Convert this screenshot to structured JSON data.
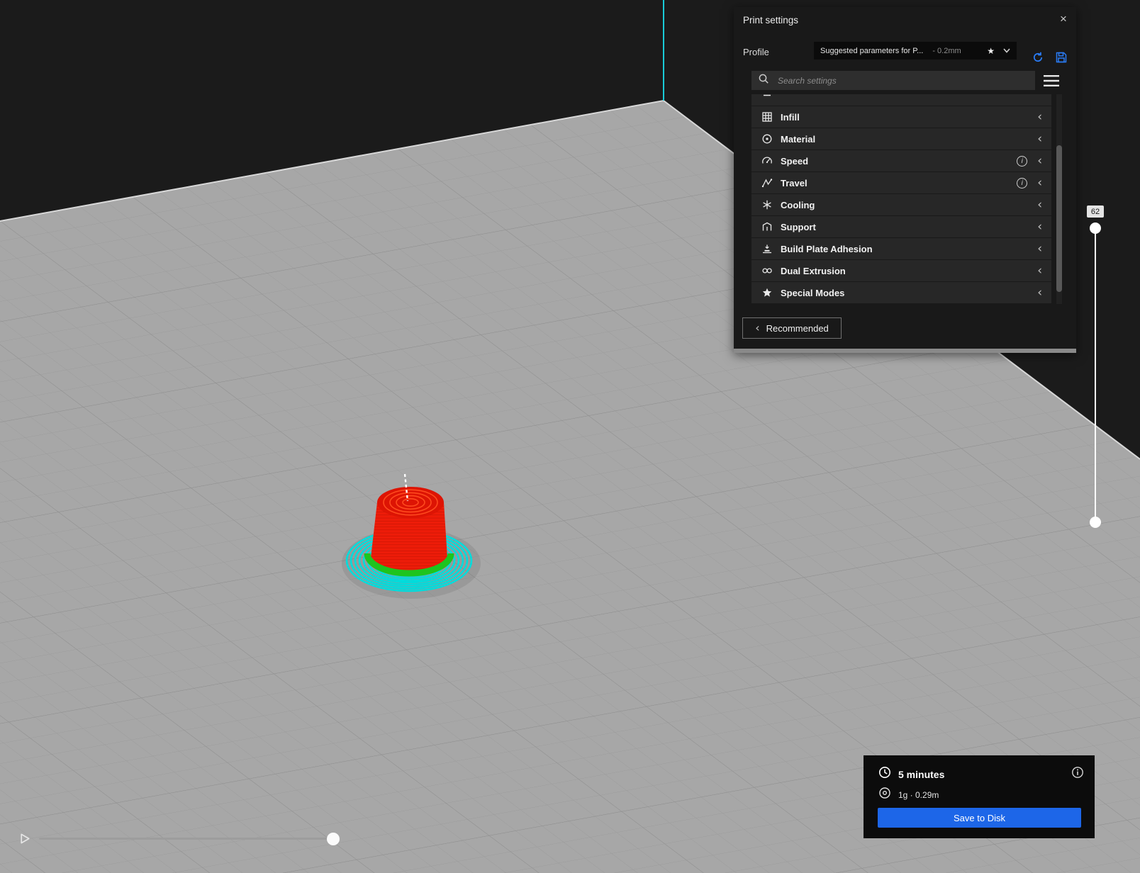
{
  "print_settings": {
    "title": "Print settings",
    "profile": {
      "label": "Profile",
      "value": "Suggested parameters for P...",
      "variant": "- 0.2mm"
    },
    "search_placeholder": "Search settings",
    "categories": [
      {
        "label": "Infill",
        "info": false
      },
      {
        "label": "Material",
        "info": false
      },
      {
        "label": "Speed",
        "info": true
      },
      {
        "label": "Travel",
        "info": true
      },
      {
        "label": "Cooling",
        "info": false
      },
      {
        "label": "Support",
        "info": false
      },
      {
        "label": "Build Plate Adhesion",
        "info": false
      },
      {
        "label": "Dual Extrusion",
        "info": false
      },
      {
        "label": "Special Modes",
        "info": false
      }
    ],
    "recommended": "Recommended"
  },
  "layer_slider": {
    "value": "62"
  },
  "job_summary": {
    "time": "5 minutes",
    "material": "1g · 0.29m",
    "save_button": "Save to Disk"
  },
  "icons": {
    "close": "×",
    "star": "★",
    "chevron": "‹",
    "info": "i"
  },
  "colors": {
    "accent_blue": "#1d66e8",
    "profile_icon_blue": "#2a7cf7",
    "model_red": "#ed1c09",
    "ring_green": "#1ec41e",
    "brim_cyan": "#00dcdc",
    "plate_gray": "#a7a7a7",
    "background_dark": "#1b1b1b",
    "axis_cyan": "#19ccd8"
  }
}
